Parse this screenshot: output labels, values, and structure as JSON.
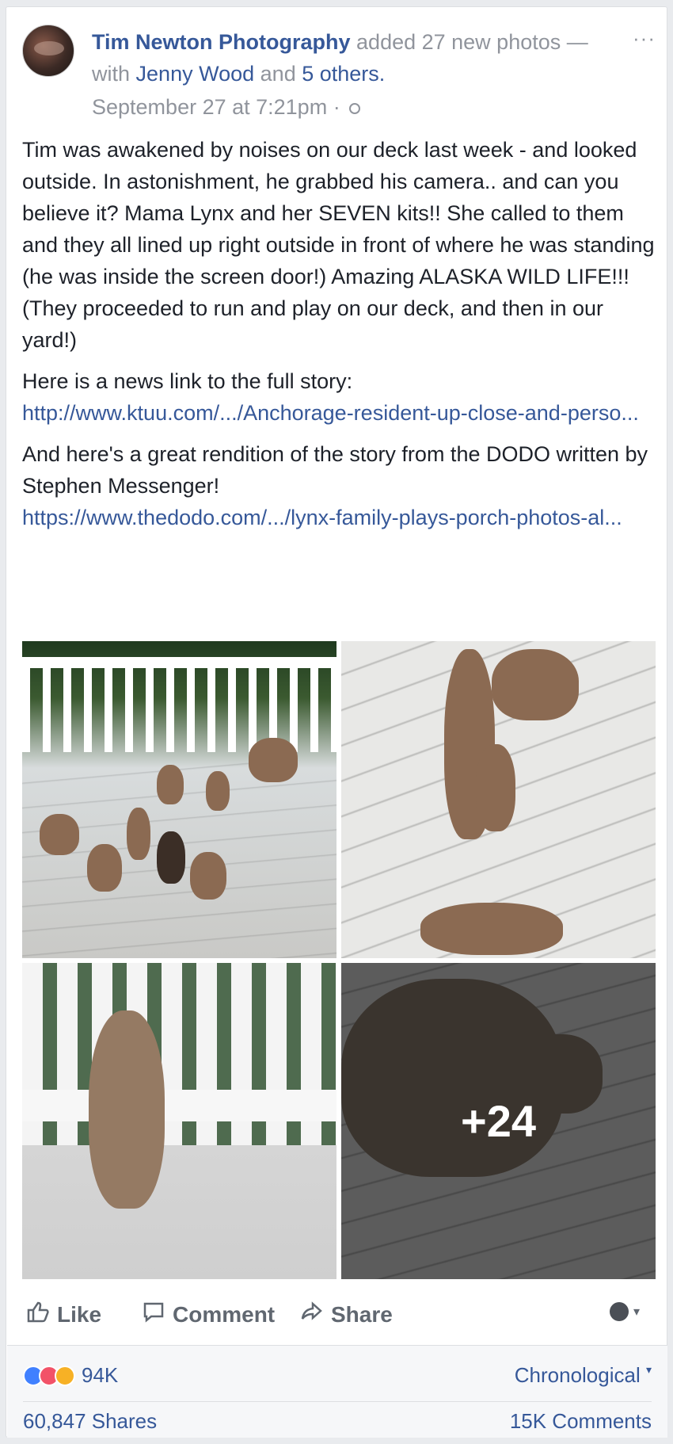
{
  "post": {
    "author": "Tim Newton Photography",
    "action": "added 27 new photos",
    "with_prefix": "— with",
    "tagged_person": "Jenny Wood",
    "and": "and",
    "others": "5 others.",
    "timestamp": "September 27 at 7:21pm",
    "separator": "·",
    "more_icon": "ellipsis-icon",
    "paragraphs": [
      "Tim was awakened by noises on our deck last week - and looked outside. In astonishment, he grabbed his camera.. and can you believe it? Mama Lynx and her SEVEN kits!! She called to them and they all lined up right outside in front of where he was standing (he was inside the screen door!) Amazing ALASKA WILD LIFE!!! (They proceeded to run and play on our deck, and then in our yard!)"
    ],
    "news_intro": "Here is a news link to the full story:",
    "news_link": "http://www.ktuu.com/.../Anchorage-resident-up-close-and-perso...",
    "dodo_intro": "And here's a great rendition of the story from the DODO written by Stephen Messenger!",
    "dodo_link": "https://www.thedodo.com/.../lynx-family-plays-porch-photos-al...",
    "more_photos": "+24"
  },
  "actions": {
    "like": "Like",
    "comment": "Comment",
    "share": "Share"
  },
  "footer": {
    "reaction_count": "94K",
    "sort": "Chronological",
    "sort_caret": "▾",
    "shares": "60,847 Shares",
    "comments": "15K Comments"
  },
  "colors": {
    "link": "#365899",
    "meta": "#90949c",
    "like": "#4080ff",
    "love": "#f25268",
    "wow": "#f7b125"
  }
}
